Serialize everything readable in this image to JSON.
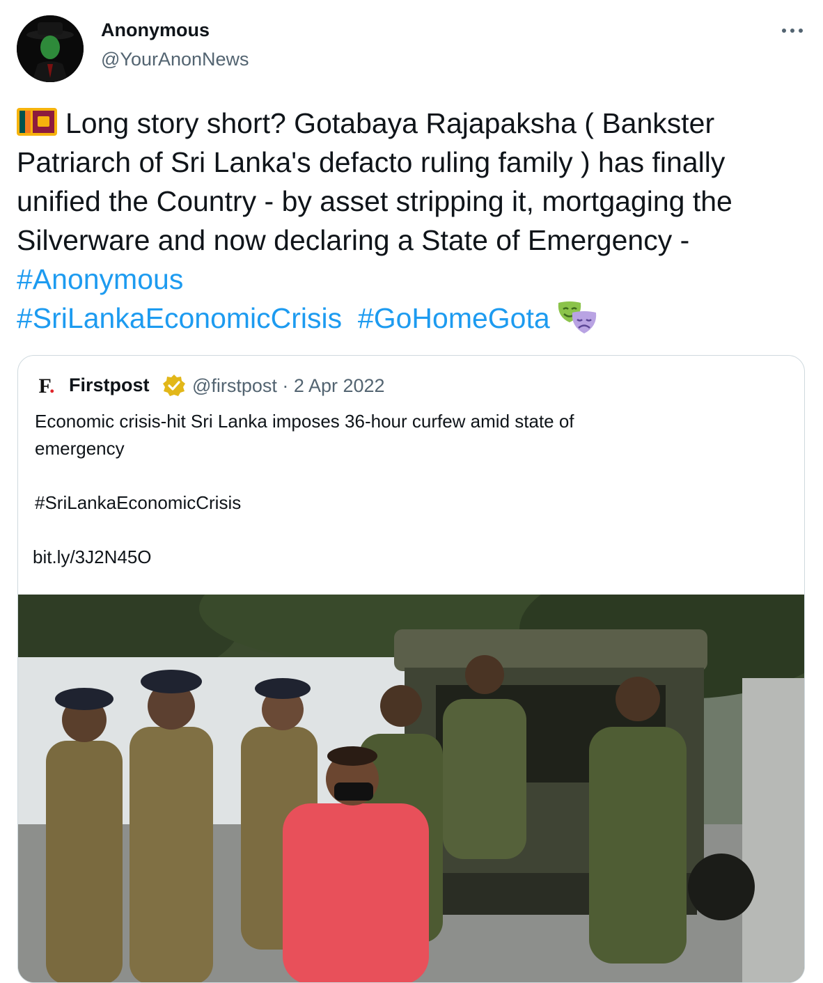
{
  "author": {
    "name": "Anonymous",
    "handle": "@YourAnonNews"
  },
  "tweet": {
    "flag_icon": "sri-lanka-flag-emoji",
    "text_main": "Long story short? Gotabaya Rajapaksha ( Bankster Patriarch of Sri Lanka's defacto ruling family ) has finally unified the Country - by asset stripping it, mortgaging the Silverware and now declaring a State of Emergency - ",
    "hashtags": [
      "#Anonymous",
      "#SriLankaEconomicCrisis",
      "#GoHomeGota"
    ],
    "end_icon": "performing-arts-masks-emoji"
  },
  "quoted": {
    "source_logo": "F.",
    "name": "Firstpost",
    "verified_icon": "gold-verified-badge",
    "handle_date": "@firstpost · 2 Apr 2022",
    "text_line1": "Economic crisis-hit Sri Lanka imposes 36-hour curfew amid state of",
    "text_line2": "emergency",
    "hashtag": "#SriLankaEconomicCrisis",
    "link": "bit.ly/3J2N45O",
    "image_icon": "news-photo-police-and-soldiers"
  },
  "colors": {
    "hashtag": "#1d9bf0",
    "secondary_text": "#536471",
    "border": "#cfd9de",
    "verified_gold": "#e2b719"
  }
}
